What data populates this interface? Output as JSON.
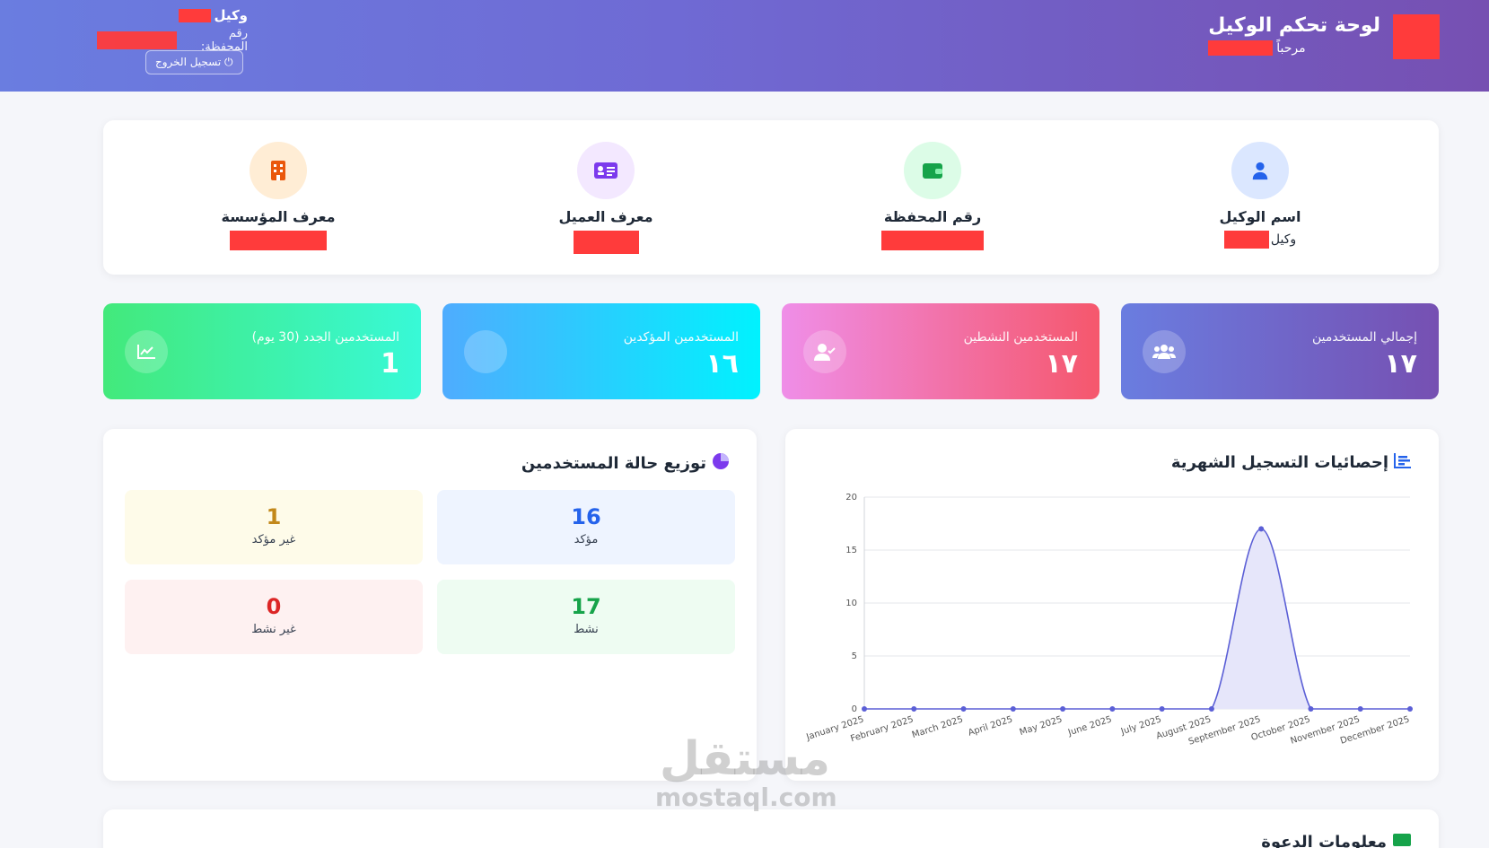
{
  "header": {
    "title": "لوحة تحكم الوكيل",
    "welcome": "مرحباً",
    "agent_prefix": "وكيل",
    "wallet_label": "رقم المحفظة:",
    "logout_label": "تسجيل الخروج"
  },
  "info": {
    "agent_name_label": "اسم الوكيل",
    "agent_name_sub": "وكيل",
    "wallet_label": "رقم المحفظة",
    "client_id_label": "معرف العميل",
    "org_id_label": "معرف المؤسسة"
  },
  "stats": {
    "total": {
      "label": "إجمالي المستخدمين",
      "value": "١٧",
      "color_from": "#6a7de0",
      "color_to": "#7650b2"
    },
    "active": {
      "label": "المستخدمين النشطين",
      "value": "١٧",
      "color_from": "#ef8ee8",
      "color_to": "#f5576c"
    },
    "confirmed": {
      "label": "المستخدمين المؤكدين",
      "value": "١٦",
      "color_from": "#4facfe",
      "color_to": "#00f2fe"
    },
    "new": {
      "label": "المستخدمين الجدد (30 يوم)",
      "value": "1",
      "color_from": "#43e97b",
      "color_to": "#38f9d7"
    }
  },
  "status_panel": {
    "title": "توزيع حالة المستخدمين",
    "confirmed": {
      "value": "16",
      "label": "مؤكد",
      "color": "#2563eb"
    },
    "unconfirmed": {
      "value": "1",
      "label": "غير مؤكد",
      "color": "#c2881a"
    },
    "active": {
      "value": "17",
      "label": "نشط",
      "color": "#16a34a"
    },
    "inactive": {
      "value": "0",
      "label": "غير نشط",
      "color": "#dc2626"
    }
  },
  "chart_panel": {
    "title": "إحصائيات التسجيل الشهرية"
  },
  "chart_data": {
    "type": "area",
    "categories": [
      "January 2025",
      "February 2025",
      "March 2025",
      "April 2025",
      "May 2025",
      "June 2025",
      "July 2025",
      "August 2025",
      "September 2025",
      "October 2025",
      "November 2025",
      "December 2025"
    ],
    "values": [
      0,
      0,
      0,
      0,
      0,
      0,
      0,
      0,
      17,
      0,
      0,
      0
    ],
    "yticks": [
      "0",
      "5",
      "10",
      "15",
      "20"
    ],
    "ylim": [
      0,
      20
    ],
    "line_color": "#5b5fd6",
    "fill_color": "#e6e6fa",
    "grid": true
  },
  "bottom": {
    "title": "معلومات الدعوة"
  },
  "watermark": {
    "ar": "مستقل",
    "en": "mostaql.com"
  }
}
